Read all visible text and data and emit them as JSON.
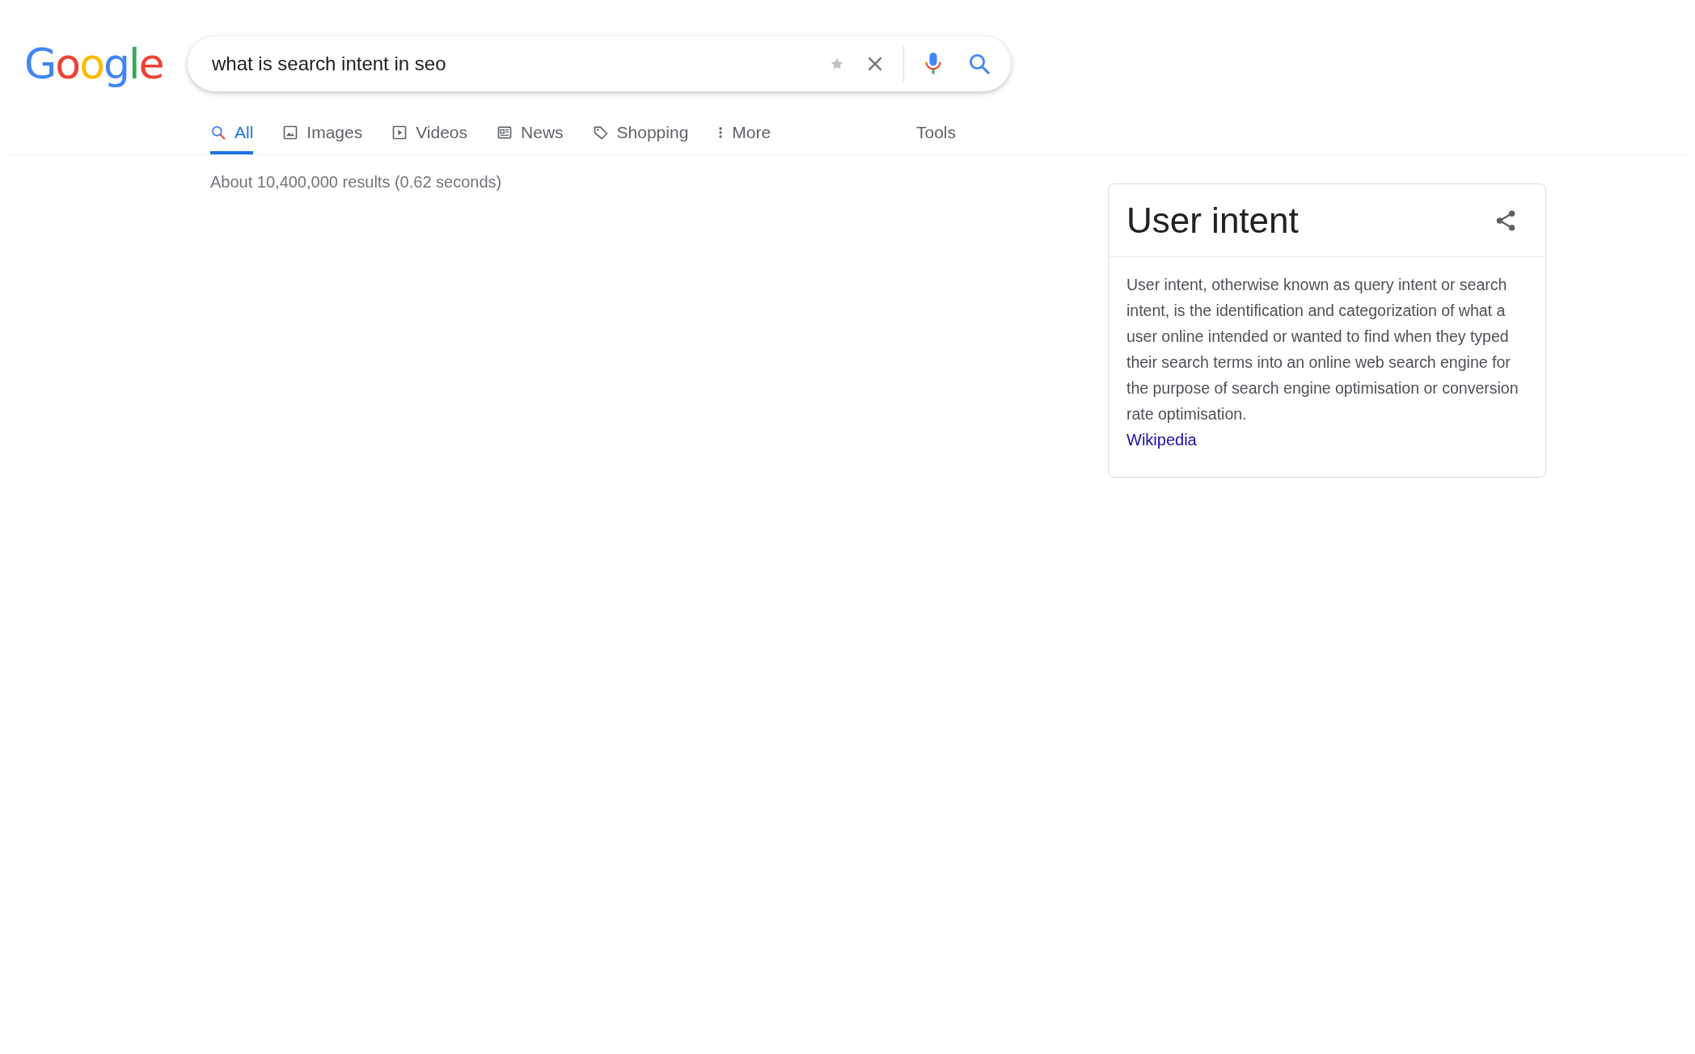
{
  "logo": {
    "text": "Google"
  },
  "search": {
    "value": "what is search intent in seo"
  },
  "tabs": [
    {
      "label": "All",
      "kind": "search",
      "selected": true
    },
    {
      "label": "Images",
      "kind": "image",
      "selected": false
    },
    {
      "label": "Videos",
      "kind": "video",
      "selected": false
    },
    {
      "label": "News",
      "kind": "news",
      "selected": false
    },
    {
      "label": "Shopping",
      "kind": "tag",
      "selected": false
    },
    {
      "label": "More",
      "kind": "more",
      "selected": false
    }
  ],
  "tools": "Tools",
  "result_stats": "About 10,400,000 results (0.62 seconds)",
  "knowledge_panel": {
    "title": "User intent",
    "description": "User intent, otherwise known as query intent or search intent, is the identification and categorization of what a user online intended or wanted to find when they typed their search terms into an online web search engine for the purpose of search engine optimisation or conversion rate optimisation.",
    "source": "Wikipedia"
  }
}
